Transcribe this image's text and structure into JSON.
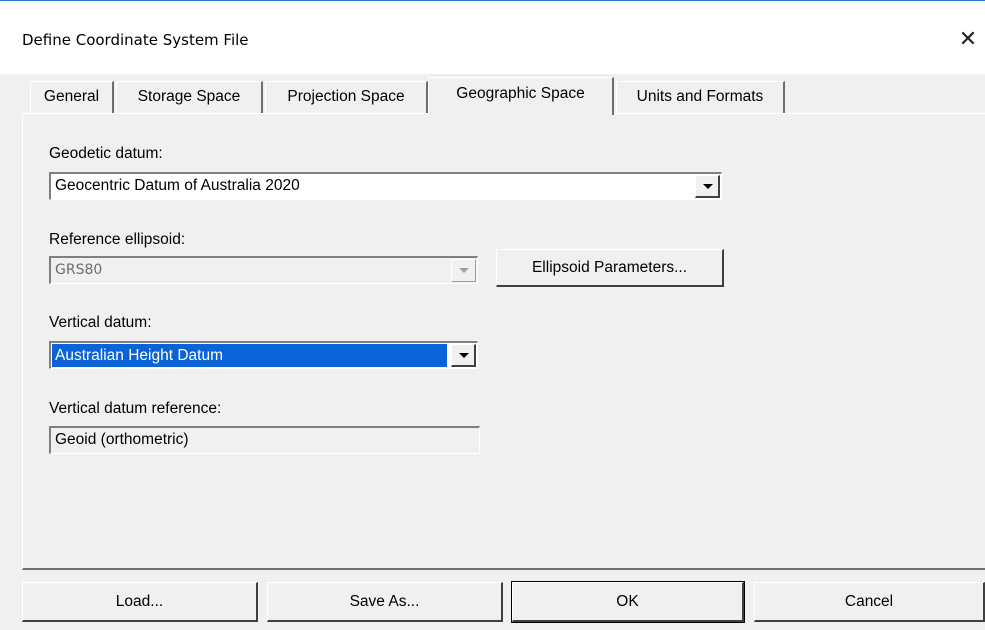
{
  "window": {
    "title": "Define Coordinate System File",
    "close_glyph": "✕"
  },
  "tabs": [
    {
      "label": "General"
    },
    {
      "label": "Storage Space"
    },
    {
      "label": "Projection Space"
    },
    {
      "label": "Geographic Space",
      "active": true
    },
    {
      "label": "Units and Formats"
    }
  ],
  "geodetic": {
    "label": "Geodetic datum:",
    "value": "Geocentric Datum of Australia 2020"
  },
  "ellipsoid": {
    "label": "Reference ellipsoid:",
    "value": "GRS80",
    "button": "Ellipsoid Parameters..."
  },
  "vertical": {
    "label": "Vertical datum:",
    "value": "Australian Height Datum"
  },
  "vertical_ref": {
    "label": "Vertical datum reference:",
    "value": "Geoid (orthometric)"
  },
  "footer": {
    "load": "Load...",
    "save_as": "Save As...",
    "ok": "OK",
    "cancel": "Cancel"
  },
  "colors": {
    "selection": "#0a64d8",
    "titlebar_border": "#2b79d0"
  }
}
